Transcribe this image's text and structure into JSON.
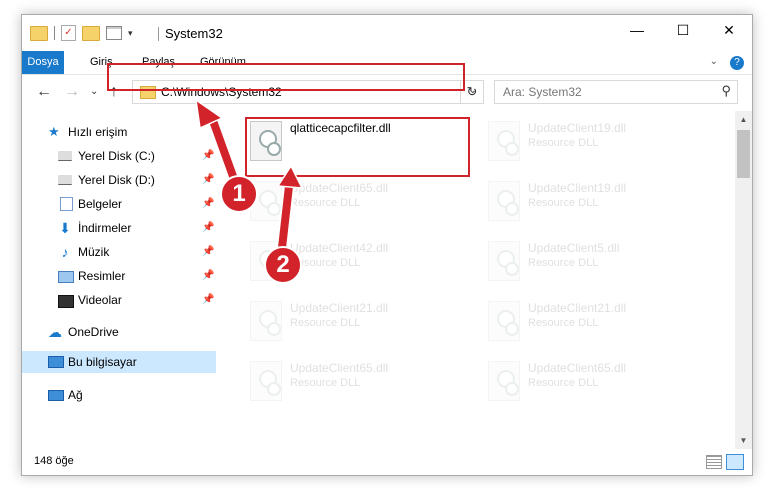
{
  "window": {
    "title": "System32",
    "minimize": "—",
    "maximize": "☐",
    "close": "✕"
  },
  "ribbon": {
    "tabs": [
      "Dosya",
      "Giriş",
      "Paylaş",
      "Görünüm"
    ],
    "expand": "⌄",
    "help": "?"
  },
  "nav": {
    "back": "←",
    "forward": "→",
    "recent": "⌄",
    "up": "↑",
    "address": "C:\\Windows\\System32",
    "address_drop": "⌄",
    "refresh": "↻",
    "search_placeholder": "Ara: System32",
    "search_icon": "⚲"
  },
  "sidebar": {
    "quick_access": "Hızlı erişim",
    "items": [
      {
        "label": "Yerel Disk (C:)",
        "icon": "drive-icon"
      },
      {
        "label": "Yerel Disk (D:)",
        "icon": "drive-icon"
      },
      {
        "label": "Belgeler",
        "icon": "documents-icon"
      },
      {
        "label": "İndirmeler",
        "icon": "downloads-icon"
      },
      {
        "label": "Müzik",
        "icon": "music-icon"
      },
      {
        "label": "Resimler",
        "icon": "pictures-icon"
      },
      {
        "label": "Videolar",
        "icon": "videos-icon"
      }
    ],
    "onedrive": "OneDrive",
    "this_pc": "Bu bilgisayar",
    "network": "Ağ",
    "pin": "📌"
  },
  "files": {
    "highlighted": {
      "name": "qlatticecapcfilter.dll",
      "type": ""
    },
    "left_column": [
      {
        "name": "UpdateClient65.dll",
        "type": "Resource DLL"
      },
      {
        "name": "UpdateClient42.dll",
        "type": "Resource DLL"
      },
      {
        "name": "UpdateClient21.dll",
        "type": "Resource DLL"
      },
      {
        "name": "UpdateClient65.dll",
        "type": "Resource DLL"
      }
    ],
    "right_column": [
      {
        "name": "UpdateClient19.dll",
        "type": "Resource DLL"
      },
      {
        "name": "UpdateClient19.dll",
        "type": "Resource DLL"
      },
      {
        "name": "UpdateClient5.dll",
        "type": "Resource DLL"
      },
      {
        "name": "UpdateClient21.dll",
        "type": "Resource DLL"
      },
      {
        "name": "UpdateClient65.dll",
        "type": "Resource DLL"
      }
    ]
  },
  "status": {
    "count": "148 öğe"
  },
  "callouts": [
    "1",
    "2"
  ],
  "colors": {
    "accent": "#1979ca",
    "highlight": "#d2232a",
    "selected": "#cce8ff"
  }
}
